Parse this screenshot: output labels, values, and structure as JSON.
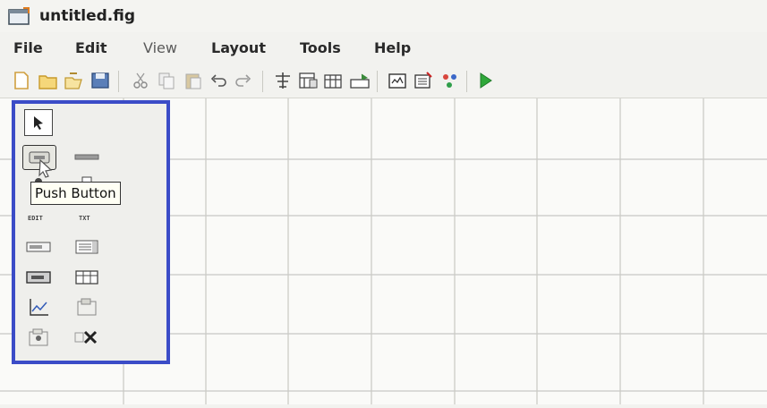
{
  "window": {
    "title": "untitled.fig"
  },
  "menu": [
    "File",
    "Edit",
    "View",
    "Layout",
    "Tools",
    "Help"
  ],
  "toolbar": {
    "icons": [
      "new-file-icon",
      "open-folder-icon",
      "open-file-icon",
      "save-icon",
      "cut-icon",
      "copy-icon",
      "paste-icon",
      "undo-icon",
      "redo-icon",
      "align-objects-icon",
      "menu-editor-icon",
      "tab-order-editor-icon",
      "toolbar-editor-icon",
      "m-file-editor-icon",
      "property-inspector-icon",
      "object-browser-icon",
      "run-figure-icon"
    ]
  },
  "palette": {
    "tooltip": "Push Button",
    "items": [
      {
        "name": "select-tool",
        "label": ""
      },
      {
        "name": "push-button-tool",
        "label": ""
      },
      {
        "name": "slider-tool",
        "label": ""
      },
      {
        "name": "radio-button-tool",
        "label": ""
      },
      {
        "name": "checkbox-tool",
        "label": ""
      },
      {
        "name": "edit-text-tool",
        "label": "EDIT"
      },
      {
        "name": "static-text-tool",
        "label": "TXT"
      },
      {
        "name": "popup-menu-tool",
        "label": ""
      },
      {
        "name": "listbox-tool",
        "label": ""
      },
      {
        "name": "toggle-button-tool",
        "label": ""
      },
      {
        "name": "table-tool",
        "label": ""
      },
      {
        "name": "axes-tool",
        "label": ""
      },
      {
        "name": "panel-tool",
        "label": ""
      },
      {
        "name": "button-group-tool",
        "label": ""
      },
      {
        "name": "activex-control-tool",
        "label": ""
      }
    ]
  },
  "colors": {
    "palette_border": "#3b4cc7",
    "grid_line": "#c8c8c4",
    "run_accent": "#2fa83a"
  }
}
